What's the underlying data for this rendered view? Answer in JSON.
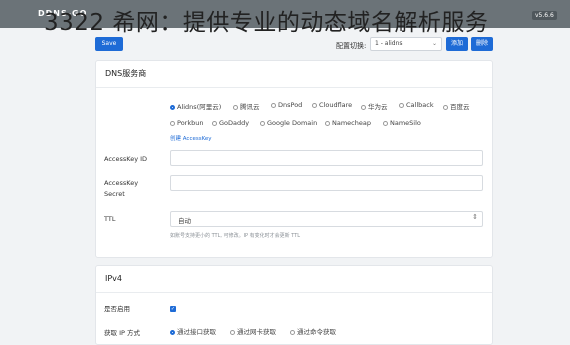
{
  "header": {
    "brand": "DDNS-GO",
    "version": "v5.6.6"
  },
  "overlay_title": "3322 希网：提供专业的动态域名解析服务",
  "toolbar": {
    "save_label": "Save",
    "config_label": "配置切换:",
    "config_value": "1 - alidns",
    "add_label": "添加",
    "delete_label": "删除"
  },
  "dns_section": {
    "title": "DNS服务商",
    "providers": [
      {
        "label": "Alidns(阿里云)",
        "selected": true
      },
      {
        "label": "腾讯云",
        "selected": false
      },
      {
        "label": "DnsPod",
        "selected": false
      },
      {
        "label": "Cloudflare",
        "selected": false
      },
      {
        "label": "华为云",
        "selected": false
      },
      {
        "label": "Callback",
        "selected": false
      },
      {
        "label": "百度云",
        "selected": false
      },
      {
        "label": "Porkbun",
        "selected": false
      },
      {
        "label": "GoDaddy",
        "selected": false
      },
      {
        "label": "Google Domain",
        "selected": false
      },
      {
        "label": "Namecheap",
        "selected": false
      },
      {
        "label": "NameSilo",
        "selected": false
      }
    ],
    "create_link": "创建 AccessKey",
    "access_id_label": "AccessKey ID",
    "access_secret_label_1": "AccessKey",
    "access_secret_label_2": "Secret",
    "ttl_label": "TTL",
    "ttl_value": "自动",
    "ttl_help": "如账号支持更小的 TTL, 可修改。IP 有变化时才会更新 TTL"
  },
  "ipv4_section": {
    "title": "IPv4",
    "enable_label": "是否启用",
    "enabled": true,
    "method_label": "获取 IP 方式",
    "methods": [
      {
        "label": "通过接口获取",
        "selected": true
      },
      {
        "label": "通过网卡获取",
        "selected": false
      },
      {
        "label": "通过命令获取",
        "selected": false
      }
    ]
  }
}
